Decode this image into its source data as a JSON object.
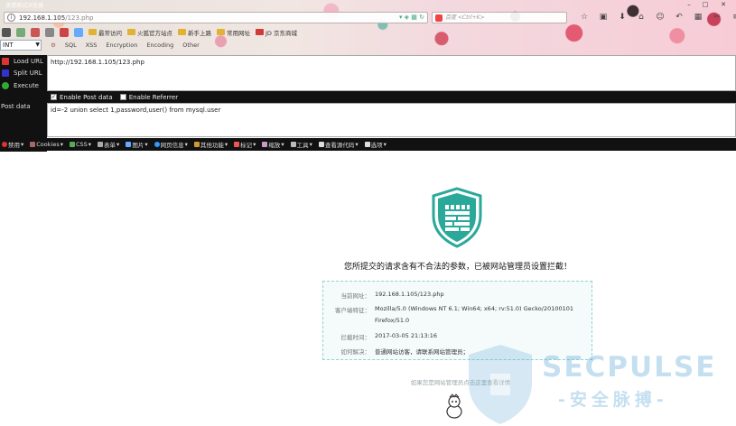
{
  "browser": {
    "app_title": "渗透测试浏览器",
    "url_host": "192.168.1.105",
    "url_path": "/123.php",
    "search_placeholder": "百度 <Ctrl+K>",
    "bookmarks": [
      {
        "label": "最常访问",
        "color": "#e2b233"
      },
      {
        "label": "火狐官方站点",
        "color": "#e2b233"
      },
      {
        "label": "新手上路",
        "color": "#e2b233"
      },
      {
        "label": "常用网址",
        "color": "#e2b233"
      },
      {
        "label": "JD 京东商城",
        "color": "#d23a3a"
      }
    ]
  },
  "hackbar": {
    "select_value": "INT",
    "menu": [
      "SQL",
      "XSS",
      "Encryption",
      "Encoding",
      "Other"
    ],
    "actions": [
      {
        "label": "Load URL",
        "icon": "load-icon",
        "color": "#d33"
      },
      {
        "label": "Split URL",
        "icon": "split-icon",
        "color": "#33c"
      },
      {
        "label": "Execute",
        "icon": "execute-icon",
        "color": "#3a3"
      }
    ],
    "url_value": "http://192.168.1.105/123.php",
    "enable_post_label": "Enable Post data",
    "enable_referrer_label": "Enable Referrer",
    "post_data_label": "Post data",
    "post_data_value": "id=-2 union select 1,password,user() from mysql.user"
  },
  "devbar": [
    {
      "label": "禁用",
      "color": "#d33"
    },
    {
      "label": "Cookies",
      "color": "#a66"
    },
    {
      "label": "CSS",
      "color": "#5a5"
    },
    {
      "label": "表单",
      "color": "#aaa"
    },
    {
      "label": "图片",
      "color": "#6af"
    },
    {
      "label": "网页信息",
      "color": "#39f"
    },
    {
      "label": "其他功能",
      "color": "#c93"
    },
    {
      "label": "标记",
      "color": "#e55"
    },
    {
      "label": "缩放",
      "color": "#c9c"
    },
    {
      "label": "工具",
      "color": "#bbb"
    },
    {
      "label": "查看源代码",
      "color": "#ddd"
    },
    {
      "label": "选项",
      "color": "#ddd"
    }
  ],
  "block_page": {
    "title": "您所提交的请求含有不合法的参数，已被网站管理员设置拦截！",
    "rows": [
      {
        "key": "当前网址：",
        "value": "192.168.1.105/123.php"
      },
      {
        "key": "客户端特征：",
        "value": "Mozilla/5.0 (Windows NT 6.1; Win64; x64; rv:51.0) Gecko/20100101"
      },
      {
        "key": "",
        "value": "Firefox/51.0"
      },
      {
        "key": "拦截时间：",
        "value": "2017-03-05 21:13:16"
      },
      {
        "key": "如何解决：",
        "value": "普通网站访客，请联系网站管理员；"
      }
    ],
    "footer_note": "如果您是网站管理员点击这里查看详情",
    "accent_color": "#2aa89a"
  },
  "watermark": {
    "text": "SECPULSE",
    "sub": "-安全脉搏-"
  }
}
